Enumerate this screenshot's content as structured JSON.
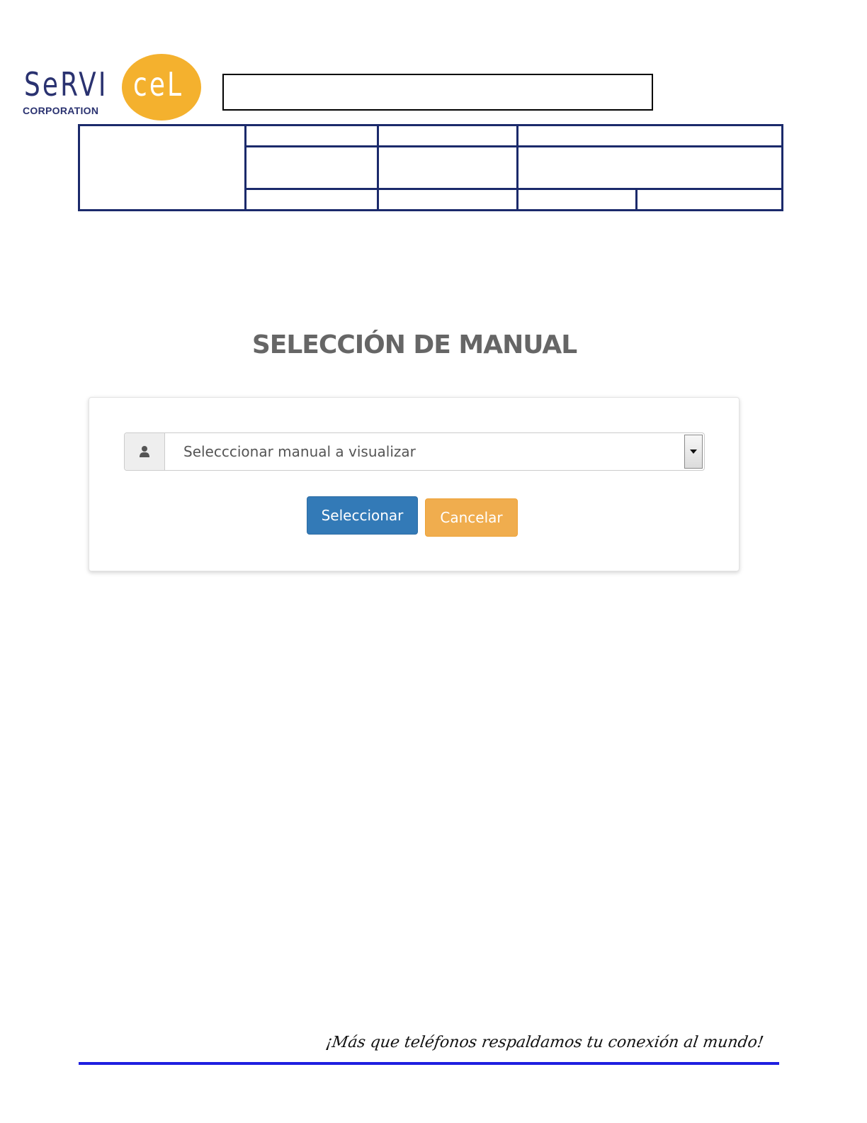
{
  "logo": {
    "text_serv": "SeRVI",
    "text_cel": "ceL",
    "text_corporation": "CORPORATION",
    "colors": {
      "navy": "#2a3270",
      "orange": "#f4b12e"
    }
  },
  "page": {
    "title": "SELECCIÓN DE MANUAL"
  },
  "form": {
    "select_icon": "user-icon",
    "select_value": "Selecccionar manual a visualizar",
    "select_button_label": "Seleccionar",
    "cancel_button_label": "Cancelar",
    "colors": {
      "primary": "#337ab7",
      "warning": "#f0ad4e"
    }
  },
  "footer": {
    "slogan": "¡Más que teléfonos respaldamos tu conexión al mundo!",
    "line_color": "#1f1fe0"
  }
}
